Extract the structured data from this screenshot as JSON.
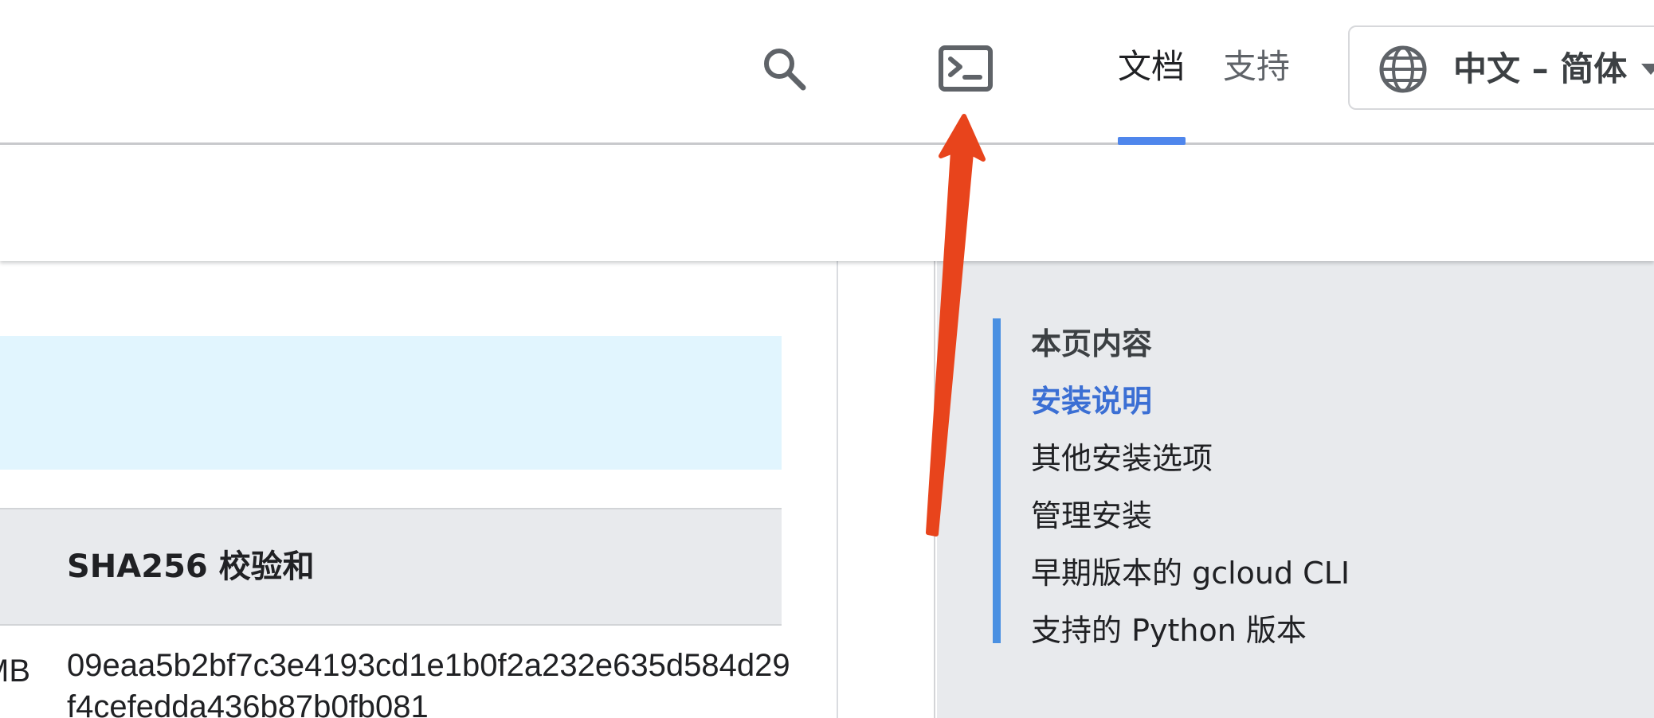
{
  "header": {
    "icons": {
      "search": "search-icon",
      "shell": "cloud-shell-terminal-icon",
      "globe": "globe-icon",
      "caret": "caret-down-icon"
    },
    "tabs": [
      {
        "label": "文档",
        "active": true
      },
      {
        "label": "支持",
        "active": false
      }
    ],
    "language": "中文 – 简体"
  },
  "main": {
    "table": {
      "headers": [
        "SHA256 校验和"
      ],
      "rows": [
        {
          "size": "MB",
          "sha256": "09eaa5b2bf7c3e4193cd1e1b0f2a232e635d584d29f4cefedda436b87b0fb081"
        }
      ]
    }
  },
  "toc": {
    "title": "本页内容",
    "items": [
      {
        "label": "安装说明",
        "active": true
      },
      {
        "label": "其他安装选项",
        "active": false
      },
      {
        "label": "管理安装",
        "active": false
      },
      {
        "label": "早期版本的 gcloud CLI",
        "active": false
      },
      {
        "label": "支持的 Python 版本",
        "active": false
      }
    ]
  },
  "colors": {
    "accent": "#4f86ec",
    "toc_active": "#3b6fd4",
    "toc_bar": "#4a90e2",
    "info_box": "#e1f5fe",
    "annotation_arrow": "#e8441c"
  },
  "annotation": {
    "type": "arrow",
    "points_to": "cloud-shell-terminal-icon"
  }
}
